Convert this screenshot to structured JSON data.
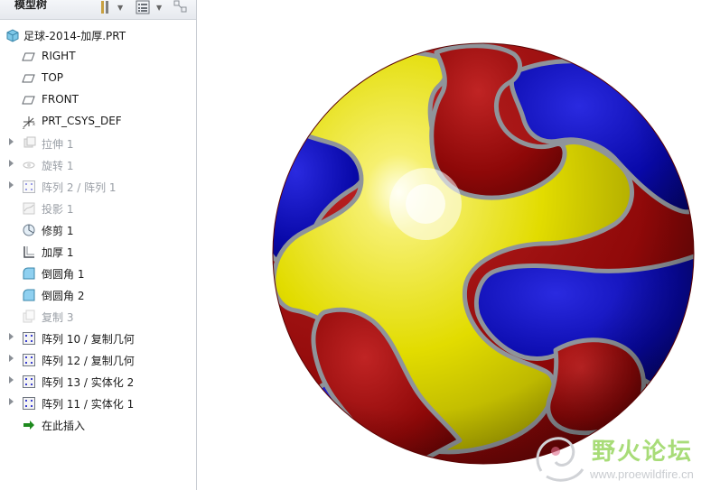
{
  "sidebar": {
    "title": "模型树",
    "toolbar_icons": [
      "settings-icon",
      "list-view-icon",
      "filter-icon"
    ]
  },
  "tree": [
    {
      "label": "足球-2014-加厚.PRT",
      "icon": "part-icon",
      "expandable": false,
      "dim": false,
      "root": true
    },
    {
      "label": "RIGHT",
      "icon": "datum-plane-icon",
      "expandable": false,
      "dim": false
    },
    {
      "label": "TOP",
      "icon": "datum-plane-icon",
      "expandable": false,
      "dim": false
    },
    {
      "label": "FRONT",
      "icon": "datum-plane-icon",
      "expandable": false,
      "dim": false
    },
    {
      "label": "PRT_CSYS_DEF",
      "icon": "coordinate-system-icon",
      "expandable": false,
      "dim": false
    },
    {
      "label": "拉伸 1",
      "icon": "extrude-icon",
      "expandable": true,
      "dim": true
    },
    {
      "label": "旋转 1",
      "icon": "revolve-icon",
      "expandable": true,
      "dim": true
    },
    {
      "label": "阵列 2 / 阵列 1",
      "icon": "pattern-icon",
      "expandable": true,
      "dim": true
    },
    {
      "label": "投影 1",
      "icon": "project-icon",
      "expandable": false,
      "dim": true
    },
    {
      "label": "修剪 1",
      "icon": "trim-icon",
      "expandable": false,
      "dim": false
    },
    {
      "label": "加厚 1",
      "icon": "thicken-icon",
      "expandable": false,
      "dim": false
    },
    {
      "label": "倒圆角 1",
      "icon": "round-icon",
      "expandable": false,
      "dim": false
    },
    {
      "label": "倒圆角 2",
      "icon": "round-icon",
      "expandable": false,
      "dim": false
    },
    {
      "label": "复制 3",
      "icon": "copy-icon",
      "expandable": false,
      "dim": true
    },
    {
      "label": "阵列 10 / 复制几何",
      "icon": "pattern-icon",
      "expandable": true,
      "dim": false
    },
    {
      "label": "阵列 12 / 复制几何",
      "icon": "pattern-icon",
      "expandable": true,
      "dim": false
    },
    {
      "label": "阵列 13 / 实体化 2",
      "icon": "pattern-icon",
      "expandable": true,
      "dim": false
    },
    {
      "label": "阵列 11 / 实体化 1",
      "icon": "pattern-icon",
      "expandable": true,
      "dim": false
    },
    {
      "label": "在此插入",
      "icon": "insert-here-arrow-icon",
      "expandable": false,
      "dim": false
    }
  ],
  "colors": {
    "red": "#9a0c0c",
    "yellow": "#e8e200",
    "blue": "#0a0aa0",
    "seam": "#8f949a"
  },
  "watermark": {
    "title": "野火论坛",
    "url": "www.proewildfire.cn"
  }
}
